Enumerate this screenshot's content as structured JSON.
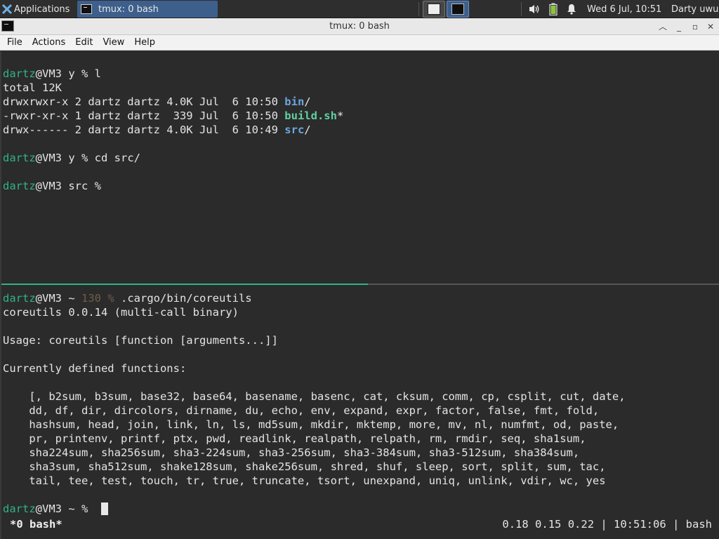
{
  "panel": {
    "applications_label": "Applications",
    "task_title": "tmux: 0 bash",
    "clock": "Wed  6 Jul, 10:51",
    "user": "Darty uwu"
  },
  "window": {
    "title": "tmux: 0 bash"
  },
  "menu": [
    "File",
    "Actions",
    "Edit",
    "View",
    "Help"
  ],
  "top_pane": {
    "lines": [
      {
        "prompt": "dartz",
        "rest": "@VM3 y % l"
      },
      {
        "text": "total 12K"
      },
      {
        "text": "drwxrwxr-x 2 dartz dartz 4.0K Jul  6 10:50 ",
        "name": "bin",
        "suffix": "/"
      },
      {
        "text": "-rwxr-xr-x 1 dartz dartz  339 Jul  6 10:50 ",
        "name": "build.sh",
        "suffix": "*"
      },
      {
        "text": "drwx------ 2 dartz dartz 4.0K Jul  6 10:49 ",
        "name": "src",
        "suffix": "/"
      },
      {
        "prompt": "dartz",
        "rest": "@VM3 y % cd src/"
      },
      {
        "prompt": "dartz",
        "rest": "@VM3 src %"
      }
    ]
  },
  "bottom_pane": {
    "prompt_user": "dartz",
    "prompt_host": "@VM3 ~ ",
    "exit_code": "130 %",
    "command": " .cargo/bin/coreutils",
    "version_line": "coreutils 0.0.14 (multi-call binary)",
    "usage_line": "Usage: coreutils [function [arguments...]]",
    "functions_header": "Currently defined functions:",
    "function_lines": [
      "    [, b2sum, b3sum, base32, base64, basename, basenc, cat, cksum, comm, cp, csplit, cut, date,",
      "    dd, df, dir, dircolors, dirname, du, echo, env, expand, expr, factor, false, fmt, fold,",
      "    hashsum, head, join, link, ln, ls, md5sum, mkdir, mktemp, more, mv, nl, numfmt, od, paste,",
      "    pr, printenv, printf, ptx, pwd, readlink, realpath, relpath, rm, rmdir, seq, sha1sum,",
      "    sha224sum, sha256sum, sha3-224sum, sha3-256sum, sha3-384sum, sha3-512sum, sha384sum,",
      "    sha3sum, sha512sum, shake128sum, shake256sum, shred, shuf, sleep, sort, split, sum, tac,",
      "    tail, tee, test, touch, tr, true, truncate, tsort, unexpand, uniq, unlink, vdir, wc, yes"
    ],
    "final_prompt_host": "@VM3 ~ %"
  },
  "status_bar": {
    "window_label": "*0 bash*",
    "right_text": "0.18 0.15 0.22 | 10:51:06 | bash"
  }
}
